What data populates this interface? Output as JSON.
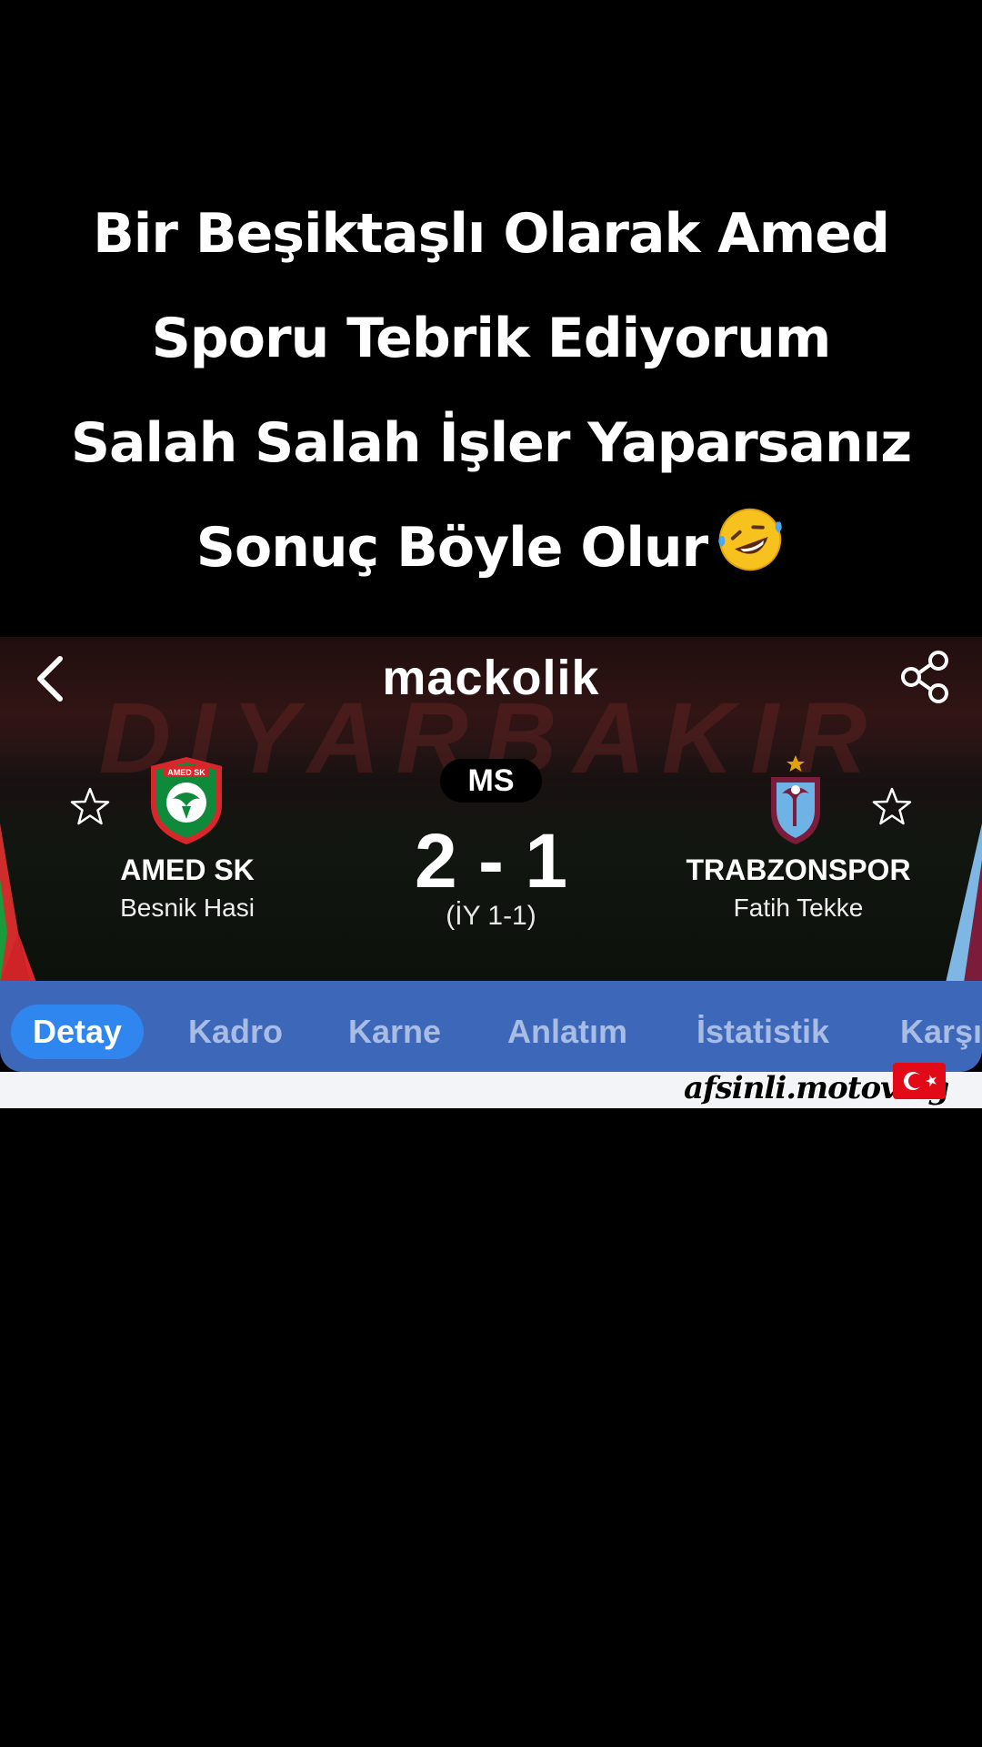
{
  "caption": {
    "lines": [
      "Bir Beşiktaşlı Olarak Amed",
      "Sporu Tebrik Ediyorum",
      "Salah Salah İşler Yaparsanız",
      "Sonuç Böyle Olur"
    ],
    "emoji": "rolling-on-floor-laughing-emoji"
  },
  "app": {
    "logo": "mackolik",
    "stands_text": "DIYARBAKIR"
  },
  "match": {
    "status": "MS",
    "score": "2 - 1",
    "halftime": "(İY 1-1)",
    "home": {
      "name": "AMED SK",
      "coach": "Besnik Hasi",
      "badge_text": "AMED SK",
      "colors": [
        "#0f8a3a",
        "#d9262a"
      ]
    },
    "away": {
      "name": "TRABZONSPOR",
      "coach": "Fatih Tekke",
      "colors": [
        "#7a1c3a",
        "#6fb3e6"
      ]
    }
  },
  "tabs": [
    "Detay",
    "Kadro",
    "Karne",
    "Anlatım",
    "İstatistik",
    "Karşı"
  ],
  "watermark": "afsinli.motovlog",
  "colors": {
    "tabbar": "#3d67b8",
    "active_tab": "#2f86ee",
    "inactive_tab_text": "#a9bde4"
  }
}
